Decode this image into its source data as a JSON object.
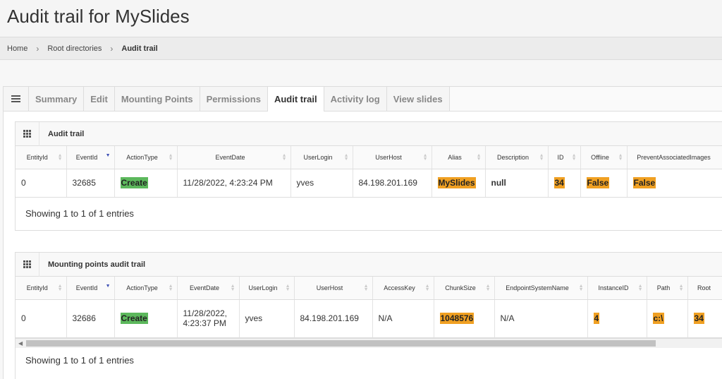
{
  "page": {
    "title": "Audit trail for MySlides"
  },
  "breadcrumb": {
    "home": "Home",
    "root": "Root directories",
    "current": "Audit trail"
  },
  "tabs": [
    {
      "label": "Summary",
      "active": false
    },
    {
      "label": "Edit",
      "active": false
    },
    {
      "label": "Mounting Points",
      "active": false
    },
    {
      "label": "Permissions",
      "active": false
    },
    {
      "label": "Audit trail",
      "active": true
    },
    {
      "label": "Activity log",
      "active": false
    },
    {
      "label": "View slides",
      "active": false
    }
  ],
  "audit_panel": {
    "title": "Audit trail",
    "columns": [
      "EntityId",
      "EventId",
      "ActionType",
      "EventDate",
      "UserLogin",
      "UserHost",
      "Alias",
      "Description",
      "ID",
      "Offline",
      "PreventAssociatedImages"
    ],
    "row": {
      "entity_id": "0",
      "event_id": "32685",
      "action_type": "Create",
      "event_date": "11/28/2022, 4:23:24 PM",
      "user_login": "yves",
      "user_host": "84.198.201.169",
      "alias": "MySlides",
      "description": "null",
      "id": "34",
      "offline": "False",
      "prevent": "False"
    },
    "showing": "Showing 1 to 1 of 1 entries"
  },
  "mounting_panel": {
    "title": "Mounting points audit trail",
    "columns": [
      "EntityId",
      "EventId",
      "ActionType",
      "EventDate",
      "UserLogin",
      "UserHost",
      "AccessKey",
      "ChunkSize",
      "EndpointSystemName",
      "InstanceID",
      "Path",
      "Root"
    ],
    "row": {
      "entity_id": "0",
      "event_id": "32686",
      "action_type": "Create",
      "event_date_line1": "11/28/2022,",
      "event_date_line2": "4:23:37 PM",
      "user_login": "yves",
      "user_host": "84.198.201.169",
      "access_key": "N/A",
      "chunk_size": "1048576",
      "endpoint": "N/A",
      "instance_id": "4",
      "path": "c:\\",
      "root": "34"
    },
    "showing": "Showing 1 to 1 of 1 entries"
  },
  "colors": {
    "create": "#5cb85c",
    "highlight": "#f0a022",
    "sort_active": "#3f51b5"
  }
}
